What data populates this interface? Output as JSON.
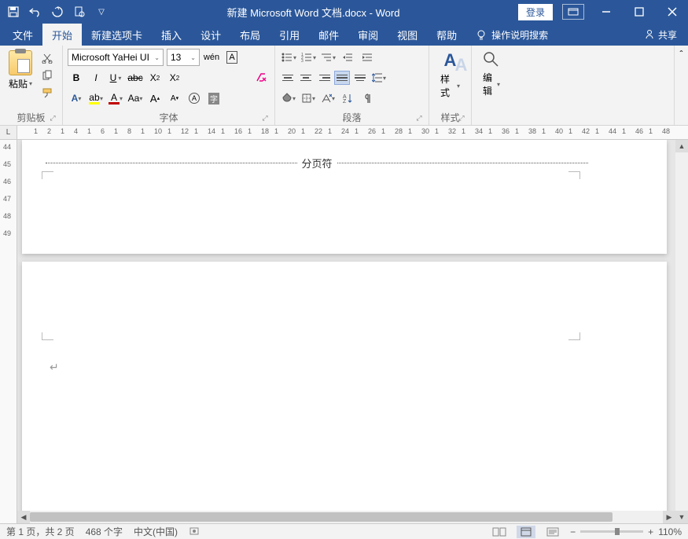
{
  "title": {
    "doc_name": "新建 Microsoft Word 文档.docx",
    "app_name": "Word",
    "separator": "  -  "
  },
  "title_buttons": {
    "login": "登录"
  },
  "tabs": {
    "file": "文件",
    "home": "开始",
    "newtab": "新建选项卡",
    "insert": "插入",
    "design": "设计",
    "layout": "布局",
    "references": "引用",
    "mailings": "邮件",
    "review": "审阅",
    "view": "视图",
    "help": "帮助",
    "tellme": "操作说明搜索",
    "share": "共享"
  },
  "ribbon": {
    "clipboard": {
      "paste": "粘贴",
      "label": "剪贴板"
    },
    "font": {
      "name": "Microsoft YaHei UI",
      "size": "13",
      "label": "字体"
    },
    "paragraph": {
      "label": "段落"
    },
    "styles": {
      "button": "样式",
      "label": "样式"
    },
    "editing": {
      "button": "编辑"
    }
  },
  "document": {
    "page_break_text": "分页符"
  },
  "status": {
    "page": "第 1 页，共 2 页",
    "words": "468 个字",
    "language": "中文(中国)",
    "zoom_pct": "110%",
    "zoom_value": 55
  },
  "ruler": {
    "marks": [
      "",
      "1",
      "2",
      "1",
      "4",
      "1",
      "6",
      "1",
      "8",
      "1",
      "10",
      "1",
      "12",
      "1",
      "14",
      "1",
      "16",
      "1",
      "18",
      "1",
      "20",
      "1",
      "22",
      "1",
      "24",
      "1",
      "26",
      "1",
      "28",
      "1",
      "30",
      "1",
      "32",
      "1",
      "34",
      "1",
      "36",
      "1",
      "38",
      "1",
      "40",
      "1",
      "42",
      "1",
      "44",
      "1",
      "46",
      "1",
      "48"
    ]
  },
  "vruler": {
    "marks": [
      "44",
      "45",
      "46",
      "47",
      "48",
      "49"
    ]
  }
}
